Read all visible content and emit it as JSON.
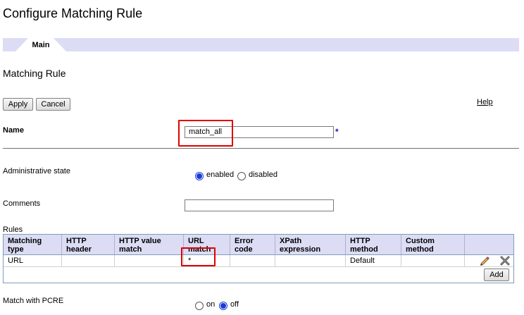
{
  "page": {
    "title": "Configure Matching Rule"
  },
  "tabs": [
    {
      "label": "Main"
    }
  ],
  "section": {
    "title": "Matching Rule"
  },
  "toolbar": {
    "apply_label": "Apply",
    "cancel_label": "Cancel",
    "help_label": "Help"
  },
  "form": {
    "name": {
      "label": "Name",
      "value": "match_all",
      "required_marker": "*"
    },
    "admin_state": {
      "label": "Administrative state",
      "options": [
        "enabled",
        "disabled"
      ],
      "selected": "enabled"
    },
    "comments": {
      "label": "Comments",
      "value": ""
    },
    "rules": {
      "label": "Rules",
      "columns": [
        "Matching type",
        "HTTP header",
        "HTTP value match",
        "URL match",
        "Error code",
        "XPath expression",
        "HTTP method",
        "Custom method",
        ""
      ],
      "rows": [
        {
          "matching_type": "URL",
          "http_header": "",
          "http_value_match": "",
          "url_match": "*",
          "error_code": "",
          "xpath_expression": "",
          "http_method": "Default",
          "custom_method": ""
        }
      ],
      "add_label": "Add",
      "row_icons": [
        "edit-pencil-icon",
        "delete-x-icon"
      ]
    },
    "pcre": {
      "label": "Match with PCRE",
      "options": [
        "on",
        "off"
      ],
      "selected": "off"
    }
  },
  "colors": {
    "tabbar": "#dcdcf5",
    "highlight_box": "#e00000",
    "radio_selected": "#1a3bd6",
    "required_star": "#1a1aa6"
  }
}
